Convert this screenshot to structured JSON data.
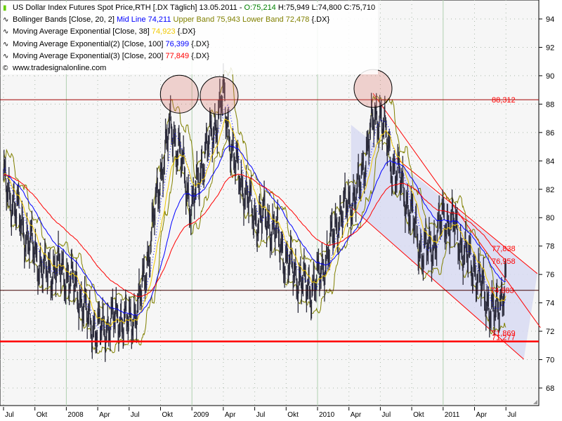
{
  "legend": {
    "title": "US Dollar Index Futures Spot Price,RTH [.DX  Täglich] 13.05.2011 - ",
    "open": "O:75,214",
    "hlc": " H:75,949 L:74,800 C:75,710",
    "bb_label": "Bollinger Bands [Close, 20, 2] ",
    "bb_mid": "Mid Line 74,211",
    "bb_upper_lower": " Upper Band 75,943 Lower Band 72,478",
    "bb_sym": " {.DX}",
    "ema1_label": "Moving Average Exponential [Close, 38] ",
    "ema1_value": "74,923",
    "ema1_sym": " {.DX}",
    "ema2_label": "Moving Average Exponential(2) [Close, 100] ",
    "ema2_value": "76,399",
    "ema2_sym": " {.DX}",
    "ema3_label": "Moving Average Exponential(3) [Close, 200] ",
    "ema3_value": "77,849",
    "ema3_sym": " {.DX}",
    "source": "www.tradesignalonline.com"
  },
  "colors": {
    "price": "#2a2a3a",
    "bb": "#808000",
    "ema1": "#f0c800",
    "ema2": "#0000ff",
    "ema3": "#ff0000",
    "channel": "#d8daf2",
    "annot": "#ff0000"
  },
  "chart_data": {
    "type": "line",
    "title": "US Dollar Index Futures Spot Price",
    "ylim": [
      67,
      95
    ],
    "yticks": [
      68,
      70,
      72,
      74,
      76,
      78,
      80,
      82,
      84,
      86,
      88,
      90,
      92,
      94
    ],
    "xticks": [
      {
        "m": 0,
        "label": "Jul"
      },
      {
        "m": 3,
        "label": "Okt"
      },
      {
        "m": 6,
        "label": "2008"
      },
      {
        "m": 9,
        "label": "Apr"
      },
      {
        "m": 12,
        "label": "Jul"
      },
      {
        "m": 15,
        "label": "Okt"
      },
      {
        "m": 18,
        "label": "2009"
      },
      {
        "m": 21,
        "label": "Apr"
      },
      {
        "m": 24,
        "label": "Jul"
      },
      {
        "m": 27,
        "label": "Okt"
      },
      {
        "m": 30,
        "label": "2010"
      },
      {
        "m": 33,
        "label": "Apr"
      },
      {
        "m": 36,
        "label": "Jul"
      },
      {
        "m": 39,
        "label": "Okt"
      },
      {
        "m": 42,
        "label": "2011"
      },
      {
        "m": 45,
        "label": "Apr"
      },
      {
        "m": 48,
        "label": "Jul"
      }
    ],
    "price_monthly": [
      82.5,
      81,
      79,
      77.5,
      76,
      76.5,
      76,
      75,
      73,
      72,
      72.5,
      73,
      72.5,
      74,
      78,
      83,
      86.5,
      84,
      80.5,
      84,
      86,
      88.5,
      84,
      82,
      80,
      80,
      79,
      77,
      76,
      75,
      75.5,
      77.5,
      80,
      81,
      82,
      86,
      87.5,
      84,
      82.5,
      80,
      77.5,
      78,
      80,
      79.5,
      77.5,
      76.5,
      74.5,
      73,
      75.7
    ],
    "levels": [
      {
        "value": 88.312,
        "label": "88,312",
        "color": "#a00000",
        "width": 1
      },
      {
        "value": 74.883,
        "label": "74,883",
        "color": "#400000",
        "width": 1
      },
      {
        "value": 71.277,
        "label": "71,277",
        "color": "#ff0000",
        "width": 2.5
      }
    ],
    "side_labels": [
      {
        "value": 77.838,
        "label": "77,838"
      },
      {
        "value": 76.958,
        "label": "76,958"
      },
      {
        "value": 71.869,
        "label": "71,869"
      }
    ],
    "channel": {
      "upper": [
        [
          33.2,
          86.54
        ],
        [
          51.0,
          76.06
        ]
      ],
      "lower": [
        [
          33.2,
          80.75
        ],
        [
          49.7,
          70.03
        ]
      ]
    },
    "trendlines": [
      [
        [
          35.3,
          88.76
        ],
        [
          51.3,
          72.25
        ]
      ],
      [
        [
          37.5,
          84.2
        ],
        [
          51.0,
          76.06
        ]
      ]
    ],
    "circles": [
      [
        16.8,
        88.7
      ],
      [
        20.6,
        88.6
      ],
      [
        35.3,
        89.1
      ]
    ]
  }
}
